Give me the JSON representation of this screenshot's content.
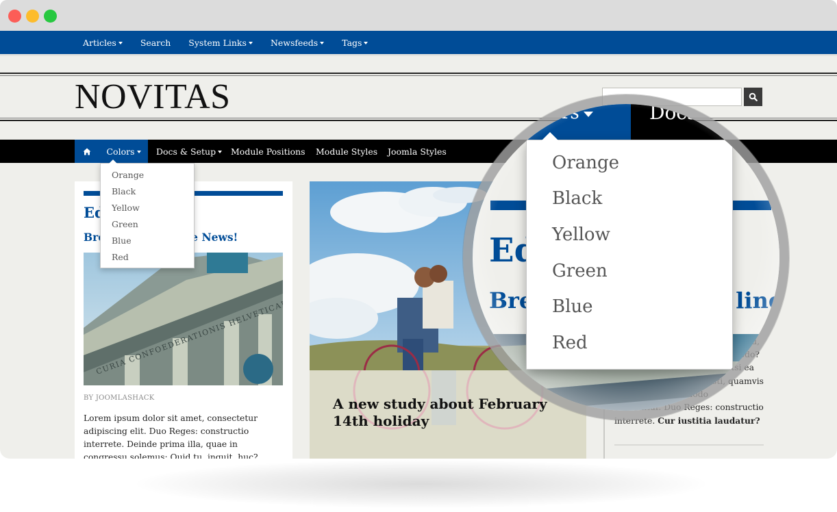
{
  "window": {
    "controls": [
      "close",
      "minimize",
      "maximize"
    ]
  },
  "topnav": {
    "items": [
      {
        "label": "Articles",
        "has_dropdown": true
      },
      {
        "label": "Search",
        "has_dropdown": false
      },
      {
        "label": "System Links",
        "has_dropdown": true
      },
      {
        "label": "Newsfeeds",
        "has_dropdown": true
      },
      {
        "label": "Tags",
        "has_dropdown": true
      }
    ]
  },
  "header": {
    "logo": "NOVITAS",
    "search": {
      "value": "",
      "placeholder": "",
      "button_icon": "search-icon"
    }
  },
  "mainnav": {
    "home_icon": "home-icon",
    "items": [
      {
        "label": "Colors",
        "has_dropdown": true,
        "active": true
      },
      {
        "label": "Docs & Setup",
        "has_dropdown": true
      },
      {
        "label": "Module Positions",
        "has_dropdown": false
      },
      {
        "label": "Module Styles",
        "has_dropdown": false
      },
      {
        "label": "Joomla Styles",
        "has_dropdown": false
      }
    ]
  },
  "colors_dropdown": {
    "items": [
      "Orange",
      "Black",
      "Yellow",
      "Green",
      "Blue",
      "Red"
    ]
  },
  "left_card": {
    "category_title": "Ed",
    "article_title_start": "Bre",
    "article_title_end": "line News!",
    "image_alt": "Curia Confoederationis Helveticae building",
    "image_caption_text": "CURIA CONFOEDERATIONIS HELVETICAE",
    "byline": "BY JOOMLASHACK",
    "body": "Lorem ipsum dolor sit amet, consectetur adipiscing elit. Duo Reges: constructio interrete. Deinde prima illa, quae in congressu solemus: Quid tu, inquit, huc? Quamquam ab iis"
  },
  "feature": {
    "image_alt": "Couple on a bicycle in a field",
    "headline": "A new study about February 14th holiday"
  },
  "right_column": {
    "lines": [
      "tu,",
      "modo?",
      "ne. Etsi ea",
      "dixisti, quamvis",
      "recte isto modo",
      "dicerentur. Duo Reges: constructio"
    ],
    "last_line_plain": "interrete. ",
    "last_line_bold": "Cur iustitia laudatur?"
  },
  "magnifier": {
    "nav_colors_fragment": "lors",
    "nav_docs_fragment": "Docs",
    "category_fragment": "Ed",
    "title_start": "Bre",
    "title_end": "line",
    "dropdown_items": [
      "Orange",
      "Black",
      "Yellow",
      "Green",
      "Blue",
      "Red"
    ]
  },
  "colors": {
    "brand_blue": "#004c97",
    "nav_black": "#000000",
    "page_bg": "#efefeb"
  }
}
